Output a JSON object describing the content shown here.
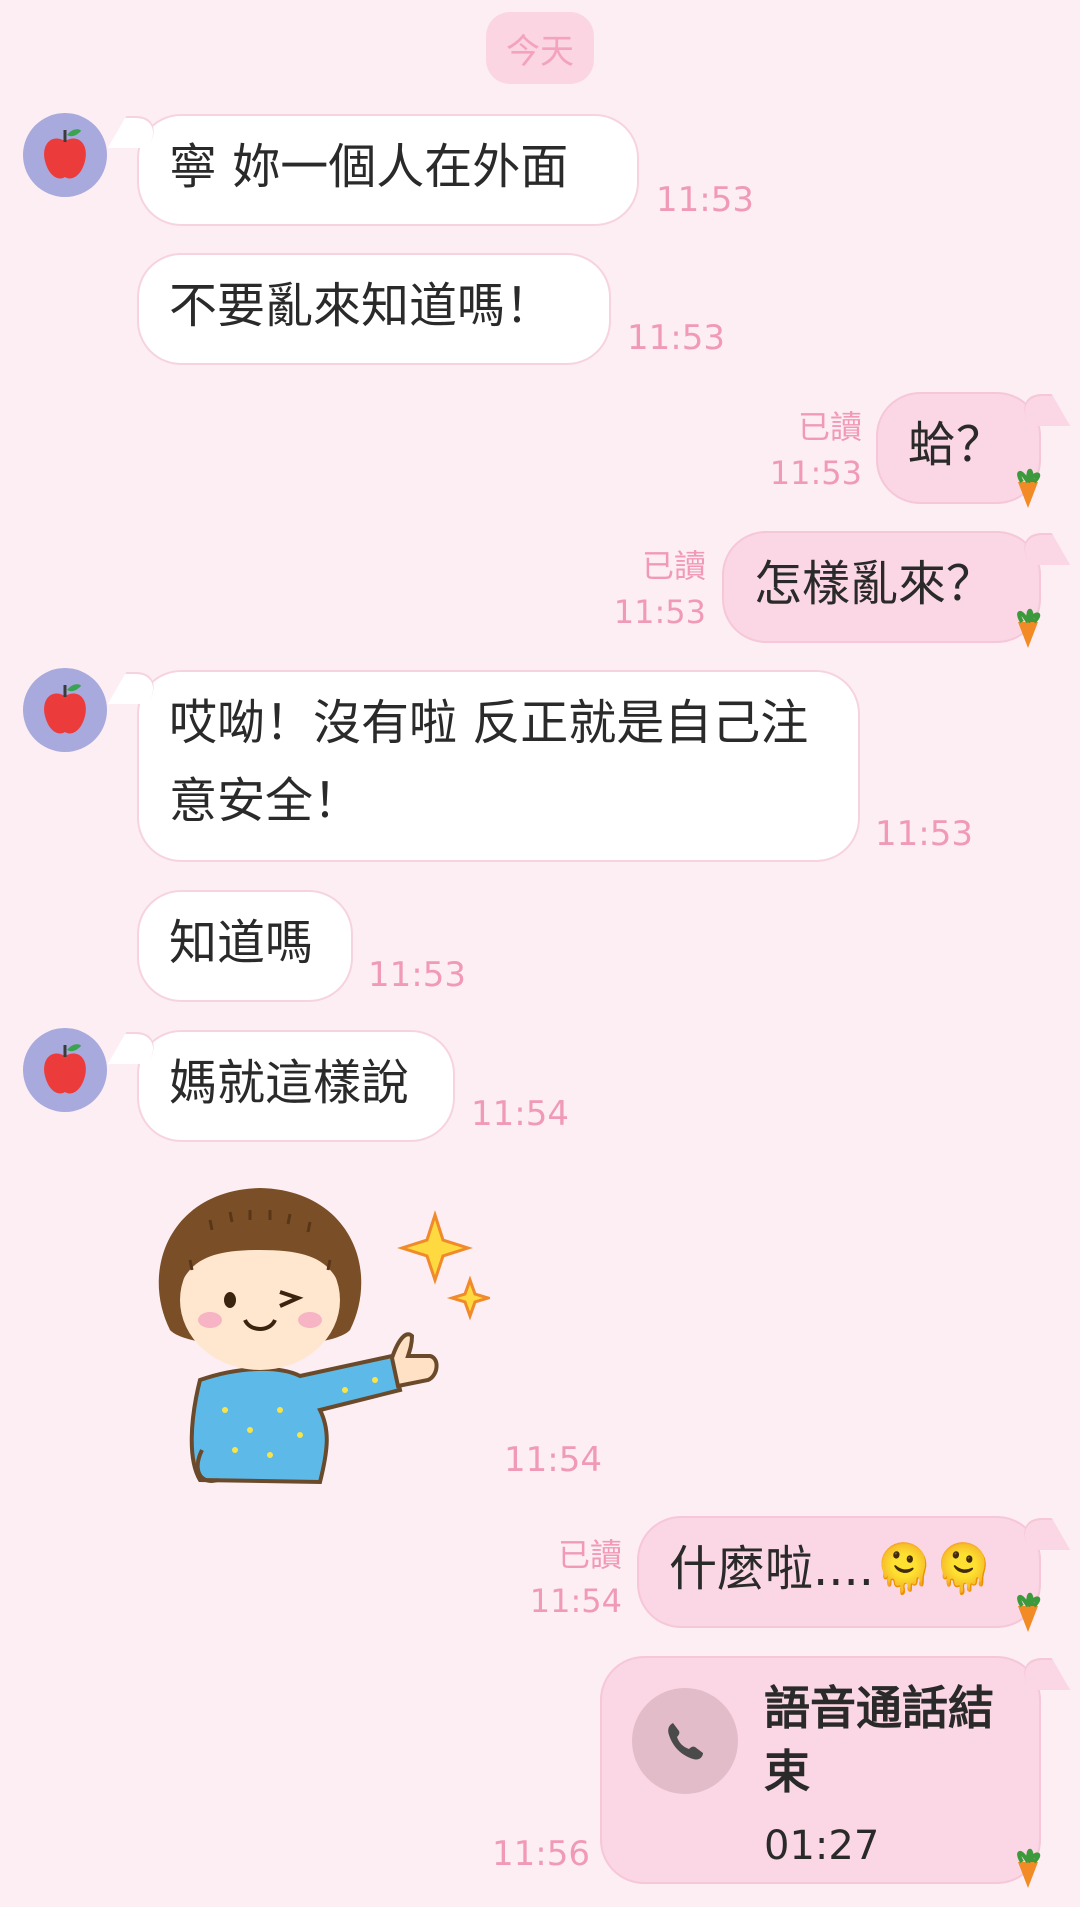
{
  "date_label": "今天",
  "messages": {
    "m1": {
      "text": "寧 妳一個人在外面",
      "time": "11:53"
    },
    "m2": {
      "text": "不要亂來知道嗎！",
      "time": "11:53"
    },
    "m3": {
      "text": "蛤？",
      "time": "11:53",
      "status": "已讀"
    },
    "m4": {
      "text": "怎樣亂來？",
      "time": "11:53",
      "status": "已讀"
    },
    "m5": {
      "text": "哎呦！沒有啦 反正就是自己注意安全！",
      "time": "11:53"
    },
    "m6": {
      "text": "知道嗎",
      "time": "11:53"
    },
    "m7": {
      "text": "媽就這樣說",
      "time": "11:54"
    },
    "m8": {
      "sticker": "girl-thumbs-up-sticker",
      "time": "11:54"
    },
    "m9": {
      "text": "什麼啦....",
      "emoji": "🫠🫠",
      "time": "11:54",
      "status": "已讀"
    },
    "m10": {
      "call_title": "語音通話結束",
      "duration": "01:27",
      "time": "11:56"
    }
  },
  "icons": {
    "avatar": "apple-avatar-icon",
    "sent_marker": "carrot-icon",
    "call": "phone-icon"
  },
  "colors": {
    "background": "#fdeef3",
    "incoming_bubble": "#ffffff",
    "outgoing_bubble": "#fbd6e4",
    "timestamp": "#f09ab8",
    "avatar_bg": "#a8a9dd"
  }
}
